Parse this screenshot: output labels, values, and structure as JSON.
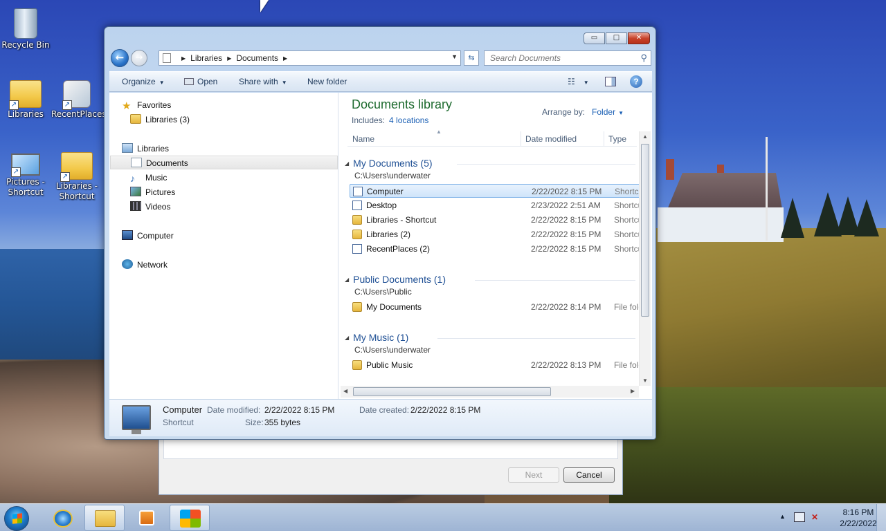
{
  "desktop": {
    "icons": [
      {
        "label": "Recycle Bin",
        "icon": "recycle-bin-icon"
      },
      {
        "label": "Libraries",
        "icon": "libraries-folder-icon"
      },
      {
        "label": "RecentPlaces",
        "icon": "recent-places-icon"
      },
      {
        "label": "Pictures - Shortcut",
        "icon": "pictures-shortcut-icon"
      },
      {
        "label": "Libraries - Shortcut",
        "icon": "libraries-shortcut-icon"
      }
    ]
  },
  "explorer": {
    "caption_buttons": {
      "minimize": "▭",
      "maximize": "□",
      "close": "✕"
    },
    "address": {
      "segments": [
        "Libraries",
        "Documents"
      ]
    },
    "search": {
      "placeholder": "Search Documents"
    },
    "toolbar": {
      "organize": "Organize",
      "open": "Open",
      "share_with": "Share with",
      "new_folder": "New folder"
    },
    "nav_pane": {
      "favorites": "Favorites",
      "favorites_child": "Libraries (3)",
      "libraries": "Libraries",
      "documents": "Documents",
      "music": "Music",
      "pictures": "Pictures",
      "videos": "Videos",
      "computer": "Computer",
      "network": "Network"
    },
    "library": {
      "title": "Documents library",
      "includes_label": "Includes:",
      "includes_link": "4 locations",
      "arrange_label": "Arrange by:",
      "arrange_value": "Folder"
    },
    "columns": {
      "name": "Name",
      "date_modified": "Date modified",
      "type": "Type"
    },
    "groups": [
      {
        "title": "My Documents (5)",
        "path": "C:\\Users\\underwater",
        "rows": [
          {
            "name": "Computer",
            "date": "2/22/2022 8:15 PM",
            "type": "Shortcut"
          },
          {
            "name": "Desktop",
            "date": "2/23/2022 2:51 AM",
            "type": "Shortcut"
          },
          {
            "name": "Libraries - Shortcut",
            "date": "2/22/2022 8:15 PM",
            "type": "Shortcut"
          },
          {
            "name": "Libraries (2)",
            "date": "2/22/2022 8:15 PM",
            "type": "Shortcut"
          },
          {
            "name": "RecentPlaces (2)",
            "date": "2/22/2022 8:15 PM",
            "type": "Shortcut"
          }
        ]
      },
      {
        "title": "Public Documents (1)",
        "path": "C:\\Users\\Public",
        "rows": [
          {
            "name": "My Documents",
            "date": "2/22/2022 8:14 PM",
            "type": "File folder"
          }
        ]
      },
      {
        "title": "My Music (1)",
        "path": "C:\\Users\\underwater",
        "rows": [
          {
            "name": "Public Music",
            "date": "2/22/2022 8:13 PM",
            "type": "File folder"
          }
        ]
      }
    ],
    "details": {
      "name": "Computer",
      "kind": "Shortcut",
      "date_modified_label": "Date modified:",
      "date_modified": "2/22/2022 8:15 PM",
      "size_label": "Size:",
      "size": "355 bytes",
      "date_created_label": "Date created:",
      "date_created": "2/22/2022 8:15 PM"
    }
  },
  "wizard": {
    "next": "Next",
    "cancel": "Cancel"
  },
  "taskbar": {
    "clock_time": "8:16 PM",
    "clock_date": "2/22/2022"
  }
}
